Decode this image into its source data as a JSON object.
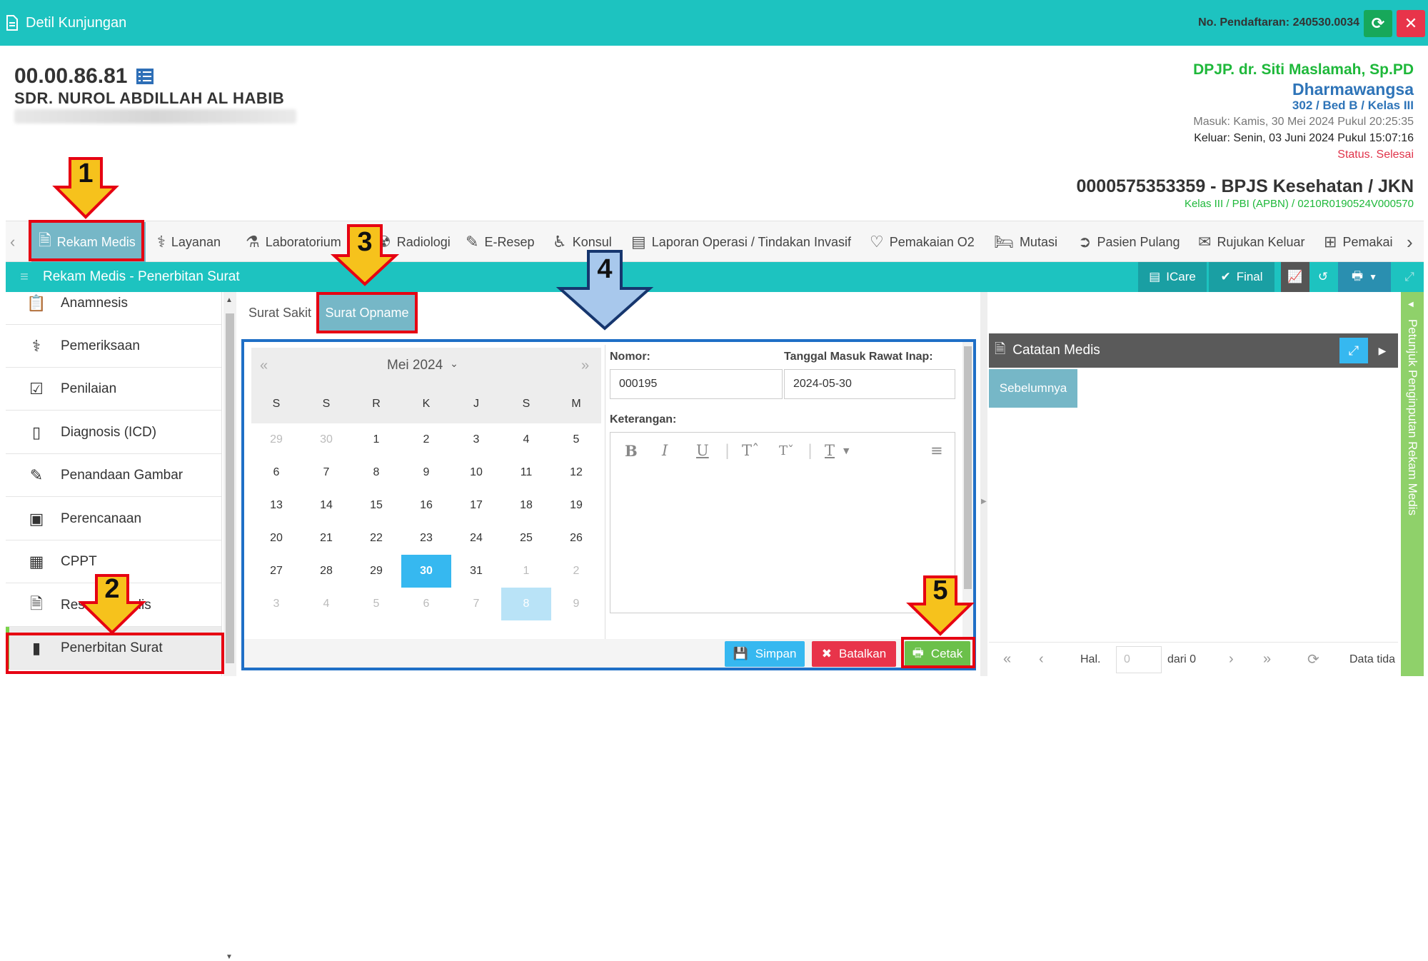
{
  "topbar": {
    "title": "Detil Kunjungan",
    "registration": "No. Pendaftaran: 240530.0034",
    "refresh_icon": "refresh-icon",
    "close_icon": "close-icon",
    "bg_color": "#1dc3c0"
  },
  "patient": {
    "id": "00.00.86.81",
    "name": "SDR. NUROL ABDILLAH AL HABIB",
    "dpjp": "DPJP. dr. Siti Maslamah, Sp.PD",
    "ward": "Dharmawangsa",
    "room": "302 / Bed B / Kelas III",
    "masuk": "Masuk: Kamis, 30 Mei 2024 Pukul 20:25:35",
    "keluar": "Keluar: Senin, 03 Juni 2024 Pukul 15:07:16",
    "status": "Status. Selesai",
    "insurance": "0000575353359 - BPJS Kesehatan / JKN",
    "insurance_detail": "Kelas III / PBI (APBN) / 0210R0190524V000570"
  },
  "nav": {
    "items": [
      {
        "label": "Rekam Medis",
        "icon": "document-icon"
      },
      {
        "label": "Layanan",
        "icon": "doctor-icon"
      },
      {
        "label": "Laboratorium",
        "icon": "flask-icon"
      },
      {
        "label": "Radiologi",
        "icon": "radiology-icon"
      },
      {
        "label": "E-Resep",
        "icon": "eraser-icon"
      },
      {
        "label": "Konsul",
        "icon": "wheelchair-icon"
      },
      {
        "label": "Laporan Operasi / Tindakan Invasif",
        "icon": "report-card-icon"
      },
      {
        "label": "Pemakaian O2",
        "icon": "heart-icon"
      },
      {
        "label": "Mutasi",
        "icon": "bed-icon"
      },
      {
        "label": "Pasien Pulang",
        "icon": "arrow-circle-icon"
      },
      {
        "label": "Rujukan Keluar",
        "icon": "envelope-icon"
      },
      {
        "label": "Pemakai",
        "icon": "medkit-icon"
      }
    ]
  },
  "panel": {
    "title": "Rekam Medis - Penerbitan Surat",
    "icare": "ICare",
    "final": "Final"
  },
  "sidebar": {
    "items": [
      {
        "label": "Anamnesis",
        "icon": "clipboard-icon"
      },
      {
        "label": "Pemeriksaan",
        "icon": "stethoscope-icon"
      },
      {
        "label": "Penilaian",
        "icon": "checklist-icon"
      },
      {
        "label": "Diagnosis (ICD)",
        "icon": "phone-doc-icon"
      },
      {
        "label": "Penandaan Gambar",
        "icon": "edit-icon"
      },
      {
        "label": "Perencanaan",
        "icon": "planning-icon"
      },
      {
        "label": "CPPT",
        "icon": "chart-doc-icon"
      },
      {
        "label": "Resume Medis",
        "icon": "file-text-icon"
      },
      {
        "label": "Penerbitan Surat",
        "icon": "file-icon"
      }
    ]
  },
  "subtabs": {
    "sakit": "Surat Sakit",
    "opname": "Surat Opname"
  },
  "calendar": {
    "month": "Mei 2024",
    "prev": "«",
    "next": "»",
    "dow": [
      "S",
      "S",
      "R",
      "K",
      "J",
      "S",
      "M"
    ],
    "weeks": [
      [
        "29",
        "30",
        "1",
        "2",
        "3",
        "4",
        "5"
      ],
      [
        "6",
        "7",
        "8",
        "9",
        "10",
        "11",
        "12"
      ],
      [
        "13",
        "14",
        "15",
        "16",
        "17",
        "18",
        "19"
      ],
      [
        "20",
        "21",
        "22",
        "23",
        "24",
        "25",
        "26"
      ],
      [
        "27",
        "28",
        "29",
        "30",
        "31",
        "1",
        "2"
      ],
      [
        "3",
        "4",
        "5",
        "6",
        "7",
        "8",
        "9"
      ]
    ],
    "selected": "30",
    "today": "8"
  },
  "form": {
    "nomor_label": "Nomor:",
    "nomor_value": "000195",
    "tanggal_label": "Tanggal Masuk Rawat Inap:",
    "tanggal_value": "2024-05-30",
    "keterangan_label": "Keterangan:",
    "simpan": "Simpan",
    "batalkan": "Batalkan",
    "cetak": "Cetak"
  },
  "notes": {
    "title": "Catatan Medis",
    "tab": "Sebelumnya",
    "side_label": "Petunjuk Penginputan Rekam Medis",
    "hal": "Hal.",
    "page_placeholder": "0",
    "dari": "dari 0",
    "data": "Data tida"
  },
  "annotations": [
    "1",
    "2",
    "3",
    "4",
    "5"
  ]
}
